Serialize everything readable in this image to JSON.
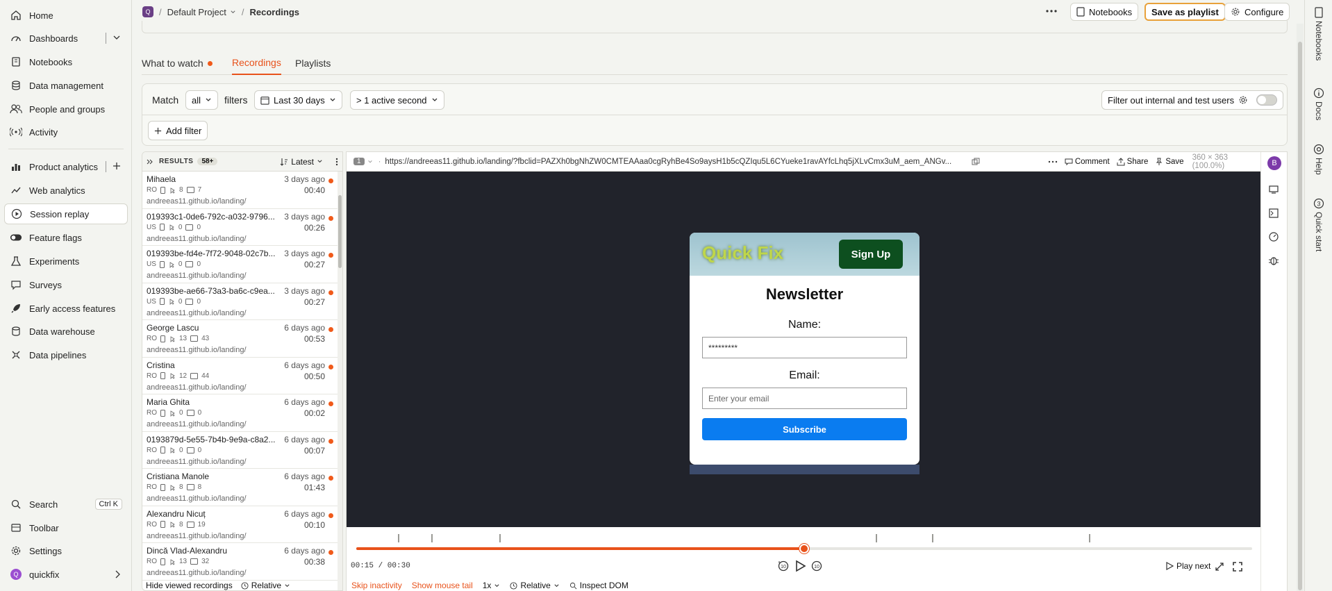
{
  "sidebar": {
    "items": [
      {
        "label": "Home",
        "icon": "home-icon"
      },
      {
        "label": "Dashboards",
        "icon": "dashboard-icon"
      },
      {
        "label": "Notebooks",
        "icon": "notebook-icon"
      },
      {
        "label": "Data management",
        "icon": "database-icon"
      },
      {
        "label": "People and groups",
        "icon": "people-icon"
      },
      {
        "label": "Activity",
        "icon": "activity-icon"
      },
      {
        "label": "Product analytics",
        "icon": "bar-chart-icon"
      },
      {
        "label": "Web analytics",
        "icon": "web-analytics-icon"
      },
      {
        "label": "Session replay",
        "icon": "play-circle-icon"
      },
      {
        "label": "Feature flags",
        "icon": "toggle-icon"
      },
      {
        "label": "Experiments",
        "icon": "flask-icon"
      },
      {
        "label": "Surveys",
        "icon": "chat-icon"
      },
      {
        "label": "Early access features",
        "icon": "rocket-icon"
      },
      {
        "label": "Data warehouse",
        "icon": "warehouse-icon"
      },
      {
        "label": "Data pipelines",
        "icon": "pipeline-icon"
      }
    ],
    "bottom": [
      {
        "label": "Search",
        "shortcut": "Ctrl K"
      },
      {
        "label": "Toolbar"
      },
      {
        "label": "Settings"
      },
      {
        "label": "quickfix",
        "avatar": "Q"
      }
    ]
  },
  "topbar": {
    "project_badge": "Q",
    "project": "Default Project",
    "page": "Recordings",
    "notebooks_label": "Notebooks",
    "save_playlist_label": "Save as playlist",
    "configure_label": "Configure"
  },
  "rightrail": [
    "Notebooks",
    "Docs",
    "Help",
    "Quick start"
  ],
  "tabs": [
    "What to watch",
    "Recordings",
    "Playlists"
  ],
  "filters": {
    "match_label": "Match",
    "match_value": "all",
    "filters_label": "filters",
    "date_range": "Last 30 days",
    "activity": "> 1 active second",
    "internal_label": "Filter out internal and test users",
    "add_filter": "Add filter"
  },
  "list": {
    "results_label": "RESULTS",
    "count": "58+",
    "sort": "Latest",
    "recordings": [
      {
        "name": "Mihaela",
        "when": "3 days ago",
        "country": "RO",
        "clicks": "8",
        "keys": "7",
        "duration": "00:40",
        "url": "andreeas11.github.io/landing/"
      },
      {
        "name": "019393c1-0de6-792c-a032-9796...",
        "when": "3 days ago",
        "country": "US",
        "clicks": "0",
        "keys": "0",
        "duration": "00:26",
        "url": "andreeas11.github.io/landing/"
      },
      {
        "name": "019393be-fd4e-7f72-9048-02c7b...",
        "when": "3 days ago",
        "country": "US",
        "clicks": "0",
        "keys": "0",
        "duration": "00:27",
        "url": "andreeas11.github.io/landing/"
      },
      {
        "name": "019393be-ae66-73a3-ba6c-c9ea...",
        "when": "3 days ago",
        "country": "US",
        "clicks": "0",
        "keys": "0",
        "duration": "00:27",
        "url": "andreeas11.github.io/landing/"
      },
      {
        "name": "George Lascu",
        "when": "6 days ago",
        "country": "RO",
        "clicks": "13",
        "keys": "43",
        "duration": "00:53",
        "url": "andreeas11.github.io/landing/"
      },
      {
        "name": "Cristina",
        "when": "6 days ago",
        "country": "RO",
        "clicks": "12",
        "keys": "44",
        "duration": "00:50",
        "url": "andreeas11.github.io/landing/"
      },
      {
        "name": "Maria Ghita",
        "when": "6 days ago",
        "country": "RO",
        "clicks": "0",
        "keys": "0",
        "duration": "00:02",
        "url": "andreeas11.github.io/landing/"
      },
      {
        "name": "0193879d-5e55-7b4b-9e9a-c8a2...",
        "when": "6 days ago",
        "country": "RO",
        "clicks": "0",
        "keys": "0",
        "duration": "00:07",
        "url": "andreeas11.github.io/landing/"
      },
      {
        "name": "Cristiana Manole",
        "when": "6 days ago",
        "country": "RO",
        "clicks": "8",
        "keys": "8",
        "duration": "01:43",
        "url": "andreeas11.github.io/landing/"
      },
      {
        "name": "Alexandru Nicuț",
        "when": "6 days ago",
        "country": "RO",
        "clicks": "8",
        "keys": "19",
        "duration": "00:10",
        "url": "andreeas11.github.io/landing/"
      },
      {
        "name": "Dincă Vlad-Alexandru",
        "when": "6 days ago",
        "country": "RO",
        "clicks": "13",
        "keys": "32",
        "duration": "00:38",
        "url": "andreeas11.github.io/landing/"
      }
    ],
    "footer_hide": "Hide viewed recordings",
    "footer_relative": "Relative"
  },
  "player": {
    "window_num": "1",
    "url": "https://andreeas11.github.io/landing/?fbclid=PAZXh0bgNhZW0CMTEAAaa0cgRyhBe4So9aysH1b5cQZIqu5L6CYueke1ravAYfcLhq5jXLvCmx3uM_aem_ANGv...",
    "comment": "Comment",
    "share": "Share",
    "save": "Save",
    "resolution": "360 × 363 (100.0%)",
    "user_avatar": "B",
    "time": "00:15 / 00:30",
    "progress_fraction": 0.5,
    "play_next": "Play next",
    "speed": "1x",
    "skip_inactivity": "Skip inactivity",
    "show_mouse_tail": "Show mouse tail",
    "relative": "Relative",
    "inspect_dom": "Inspect DOM"
  },
  "site": {
    "logo": "Quick Fix",
    "signup": "Sign Up",
    "title": "Newsletter",
    "name_label": "Name:",
    "name_value": "*********",
    "email_label": "Email:",
    "email_placeholder": "Enter your email",
    "subscribe": "Subscribe"
  },
  "colors": {
    "accent": "#e8521b",
    "subscribe": "#0a7cf0",
    "signup": "#0d4f1f"
  }
}
